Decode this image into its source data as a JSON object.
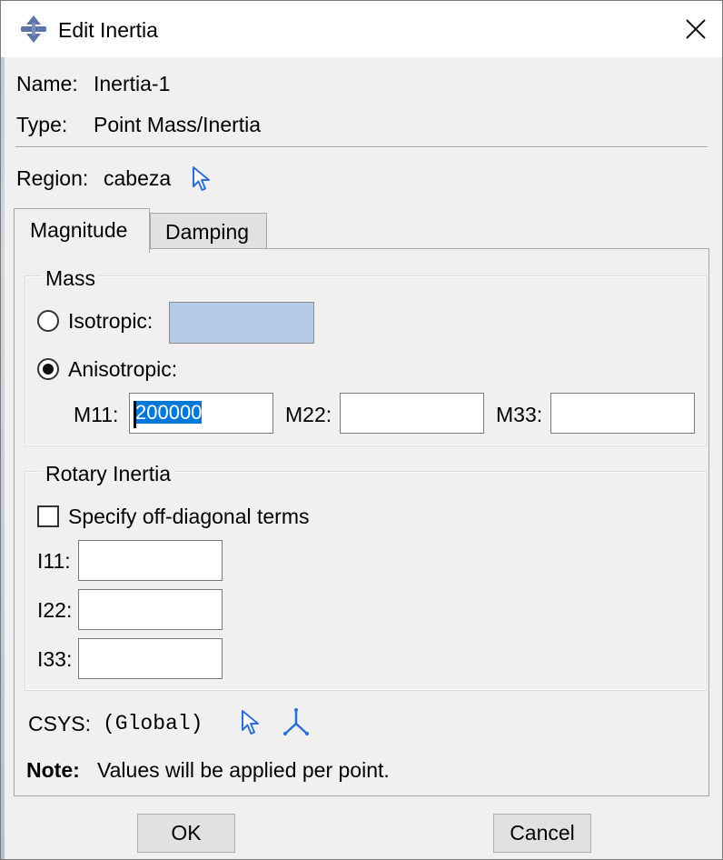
{
  "window": {
    "title": "Edit Inertia",
    "close_symbol": "✕"
  },
  "info": {
    "name_label": "Name:",
    "name_value": "Inertia-1",
    "type_label": "Type:",
    "type_value": "Point Mass/Inertia",
    "region_label": "Region:",
    "region_value": "cabeza"
  },
  "tabs": [
    {
      "label": "Magnitude",
      "active": true
    },
    {
      "label": "Damping",
      "active": false
    }
  ],
  "mass": {
    "group_title": "Mass",
    "isotropic_label": "Isotropic:",
    "isotropic_value": "",
    "anisotropic_label": "Anisotropic:",
    "selected": "anisotropic",
    "m11_label": "M11:",
    "m11_value": "200000",
    "m22_label": "M22:",
    "m22_value": "",
    "m33_label": "M33:",
    "m33_value": ""
  },
  "rotary": {
    "group_title": "Rotary Inertia",
    "offdiag_label": "Specify off-diagonal terms",
    "offdiag_checked": false,
    "i11_label": "I11:",
    "i11_value": "",
    "i22_label": "I22:",
    "i22_value": "",
    "i33_label": "I33:",
    "i33_value": ""
  },
  "csys": {
    "label": "CSYS:",
    "value": "(Global)"
  },
  "note": {
    "label": "Note:",
    "text": "Values will be applied per point."
  },
  "buttons": {
    "ok": "OK",
    "cancel": "Cancel"
  },
  "colors": {
    "titlebar": "#ffffff",
    "dialog_bg": "#f0f0f0",
    "pick_icon": "#2b6fd6",
    "selection": "#0078d7",
    "disabled_field": "#b5cbe8"
  },
  "icons": {
    "app": "abaqus-dialog-icon",
    "close": "close-icon",
    "region_pick": "select-arrow-icon",
    "csys_pick": "select-arrow-icon",
    "csys_create": "axes-triad-icon"
  }
}
